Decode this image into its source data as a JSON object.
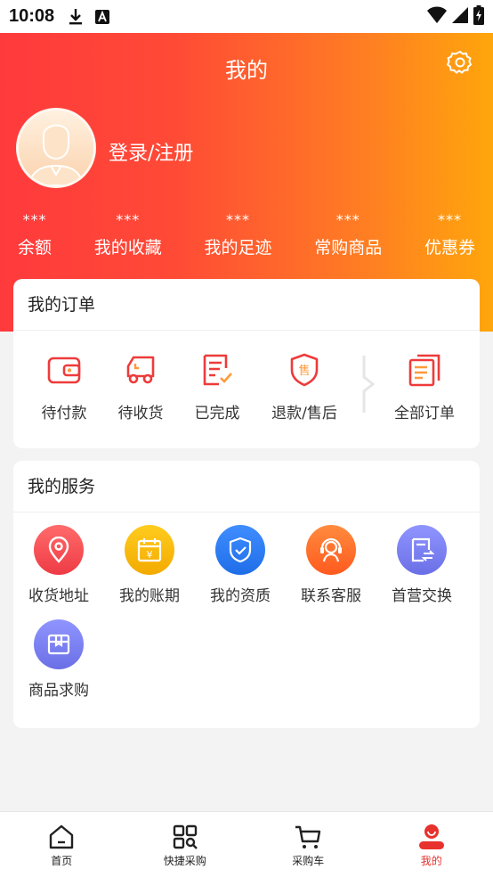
{
  "status_bar": {
    "time": "10:08"
  },
  "header": {
    "title": "我的",
    "login_text": "登录/注册"
  },
  "stats": [
    {
      "value": "***",
      "label": "余额"
    },
    {
      "value": "***",
      "label": "我的收藏"
    },
    {
      "value": "***",
      "label": "我的足迹"
    },
    {
      "value": "***",
      "label": "常购商品"
    },
    {
      "value": "***",
      "label": "优惠券"
    }
  ],
  "orders": {
    "title": "我的订单",
    "items": [
      {
        "label": "待付款",
        "icon": "wallet-icon"
      },
      {
        "label": "待收货",
        "icon": "truck-icon"
      },
      {
        "label": "已完成",
        "icon": "checked-document-icon"
      },
      {
        "label": "退款/售后",
        "icon": "after-sale-shield-icon"
      },
      {
        "label": "全部订单",
        "icon": "document-list-icon"
      }
    ]
  },
  "services": {
    "title": "我的服务",
    "items": [
      {
        "label": "收货地址",
        "icon": "location-pin-icon",
        "color": "#f2535a"
      },
      {
        "label": "我的账期",
        "icon": "calendar-yen-icon",
        "color": "#f7b500"
      },
      {
        "label": "我的资质",
        "icon": "shield-check-icon",
        "color": "#2f7cf6"
      },
      {
        "label": "联系客服",
        "icon": "customer-service-icon",
        "color": "#ff6a2c"
      },
      {
        "label": "首营交换",
        "icon": "exchange-document-icon",
        "color": "#7b83f2"
      },
      {
        "label": "商品求购",
        "icon": "box-icon",
        "color": "#7b83f2"
      }
    ]
  },
  "tabs": [
    {
      "label": "首页",
      "icon": "home-icon"
    },
    {
      "label": "快捷采购",
      "icon": "quick-purchase-icon"
    },
    {
      "label": "采购车",
      "icon": "cart-icon"
    },
    {
      "label": "我的",
      "icon": "profile-icon",
      "active": true
    }
  ],
  "colors": {
    "accent": "#e8322e",
    "gradient_start": "#ff3a3c",
    "gradient_end": "#ffa60c"
  }
}
